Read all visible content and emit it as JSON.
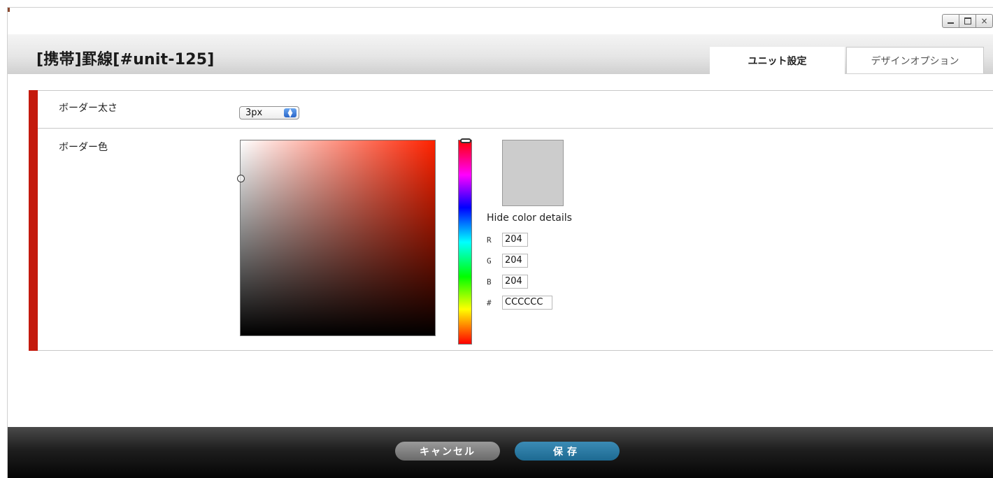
{
  "window": {
    "minimize_glyph": "",
    "maximize_glyph": "",
    "close_glyph": "×"
  },
  "header": {
    "title": "[携帯]罫線[#unit-125]",
    "tabs": [
      {
        "label": "ユニット設定",
        "active": true
      },
      {
        "label": "デザインオプション",
        "active": false
      }
    ]
  },
  "form": {
    "rows": [
      {
        "label": "ボーダー太さ",
        "control": "select",
        "value": "3px"
      },
      {
        "label": "ボーダー色",
        "control": "color-picker"
      }
    ]
  },
  "color_picker": {
    "hue_color": "#ff2200",
    "preview_color": "#cccccc",
    "hide_details_label": "Hide color details",
    "channels": [
      {
        "label": "R",
        "value": "204"
      },
      {
        "label": "G",
        "value": "204"
      },
      {
        "label": "B",
        "value": "204"
      },
      {
        "label": "#",
        "value": "CCCCCC"
      }
    ]
  },
  "footer": {
    "cancel_label": "キャンセル",
    "save_label": "保存"
  },
  "colors": {
    "accent_red": "#c41a0d",
    "save_blue": "#1d6a92",
    "cancel_gray": "#6a6a6a",
    "footer_dark": "#0a0a0a"
  },
  "icons": {
    "select_arrows": "updown-arrows-icon",
    "minimize": "minimize-icon",
    "maximize": "maximize-icon",
    "close": "close-icon"
  }
}
